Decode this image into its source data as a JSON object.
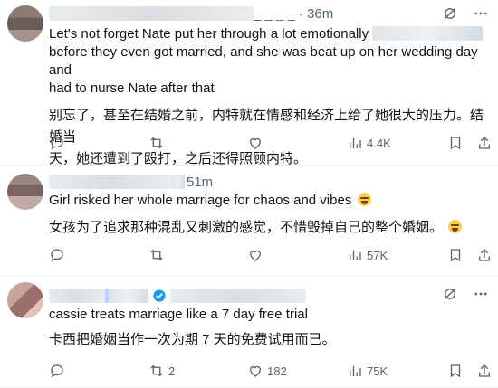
{
  "tweets": [
    {
      "time": "· 36m",
      "text_en": "Let's not forget Nate put her through a lot emotionally [redacted] before they even got married, and she was beat up on her wedding day and had to nurse Nate after that",
      "text_en_line1": "Let's not forget Nate put her through a lot emotionally",
      "text_en_line2": "before they even got married, and she was beat up on her wedding day and",
      "text_en_line3": "had to nurse Nate after that",
      "text_zh_line1": "别忘了，甚至在结婚之前，内特就在情感和经济上给了她很大的压力。结婚当",
      "text_zh_line2": "天，她还遭到了殴打，之后还得照顾内特。",
      "replies": "",
      "reposts": "",
      "likes": "",
      "views": "4.4K"
    },
    {
      "time": "51m",
      "text_en": "Girl risked her whole marriage for chaos and vibes",
      "text_zh": "女孩为了追求那种混乱又刺激的感觉，不惜毁掉自己的整个婚姻。",
      "replies": "",
      "reposts": "",
      "likes": "",
      "views": "57K"
    },
    {
      "time": "",
      "text_en": "cassie treats marriage like a 7 day free trial",
      "text_zh": "卡西把婚姻当作一次为期 7 天的免费试用而已。",
      "replies": "",
      "reposts": "2",
      "likes": "182",
      "views": "75K"
    }
  ],
  "icons": {
    "reply": "reply-icon",
    "repost": "repost-icon",
    "like": "heart-icon",
    "views": "views-icon",
    "bookmark": "bookmark-icon",
    "share": "share-icon",
    "grok": "grok-icon",
    "more": "more-icon"
  },
  "colors": {
    "text": "#0f1419",
    "muted": "#536471",
    "verified": "#1d9bf0"
  }
}
